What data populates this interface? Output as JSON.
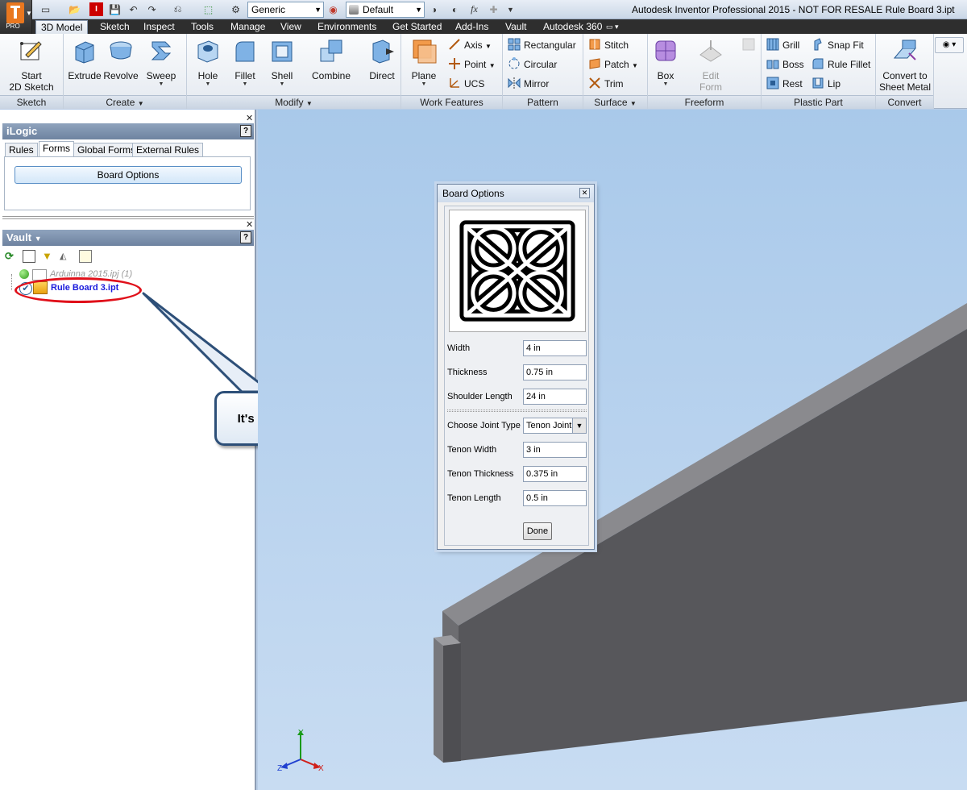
{
  "window": {
    "title": "Autodesk Inventor Professional 2015 - NOT FOR RESALE   Rule Board 3.ipt",
    "app_badge": "PRO"
  },
  "quick_access": {
    "appearance_combo": "Generic",
    "material_combo": "Default",
    "fx_symbol": "fx"
  },
  "menu_tabs": [
    "3D Model",
    "Sketch",
    "Inspect",
    "Tools",
    "Manage",
    "View",
    "Environments",
    "Get Started",
    "Add-Ins",
    "Vault",
    "Autodesk 360"
  ],
  "ribbon": {
    "groups": [
      "Sketch",
      "Create",
      "Modify",
      "Work Features",
      "Pattern",
      "Surface",
      "Freeform",
      "Plastic Part",
      "Convert"
    ],
    "sketch": {
      "start_line1": "Start",
      "start_line2": "2D Sketch"
    },
    "create": {
      "extrude": "Extrude",
      "revolve": "Revolve",
      "sweep": "Sweep"
    },
    "modify": {
      "hole": "Hole",
      "fillet": "Fillet",
      "shell": "Shell",
      "combine": "Combine",
      "direct": "Direct"
    },
    "work": {
      "plane": "Plane",
      "axis": "Axis",
      "point": "Point",
      "ucs": "UCS"
    },
    "pattern": {
      "rectangular": "Rectangular",
      "circular": "Circular",
      "mirror": "Mirror"
    },
    "surface": {
      "stitch": "Stitch",
      "patch": "Patch",
      "trim": "Trim"
    },
    "freeform": {
      "box": "Box",
      "edit_line1": "Edit",
      "edit_line2": "Form"
    },
    "plastic": {
      "grill": "Grill",
      "boss": "Boss",
      "rest": "Rest",
      "snap_fit": "Snap Fit",
      "rule_fillet": "Rule Fillet",
      "lip": "Lip"
    },
    "convert": {
      "line1": "Convert to",
      "line2": "Sheet Metal"
    }
  },
  "ilogic": {
    "title": "iLogic",
    "tabs": [
      "Rules",
      "Forms",
      "Global Forms",
      "External Rules"
    ],
    "active_tab": "Forms",
    "board_button": "Board Options"
  },
  "vault": {
    "title": "Vault",
    "tree": [
      {
        "name": "Arduinna 2015.ipj (1)"
      },
      {
        "name": "Rule Board 3.ipt"
      }
    ],
    "callout": "It's checked out!"
  },
  "dialog": {
    "title": "Board Options",
    "fields": [
      {
        "label": "Width",
        "value": "4 in"
      },
      {
        "label": "Thickness",
        "value": "0.75 in"
      },
      {
        "label": "Shoulder Length",
        "value": "24 in"
      }
    ],
    "joint_label": "Choose Joint Type",
    "joint_value": "Tenon Joint",
    "tenon_fields": [
      {
        "label": "Tenon Width",
        "value": "3 in"
      },
      {
        "label": "Tenon Thickness",
        "value": "0.375 in"
      },
      {
        "label": "Tenon Length",
        "value": "0.5 in"
      }
    ],
    "done": "Done"
  },
  "triad": {
    "y": "Y",
    "z": "Z",
    "x": "X"
  },
  "colors": {
    "viewport_top": "#a9c9ea",
    "viewport_bottom": "#c8dcf2",
    "beam_top": "#8a8a8e",
    "beam_front": "#57575b",
    "callout_border": "#2d4f78",
    "highlight_ellipse": "#e0101a",
    "tree_link": "#1a1adc"
  }
}
